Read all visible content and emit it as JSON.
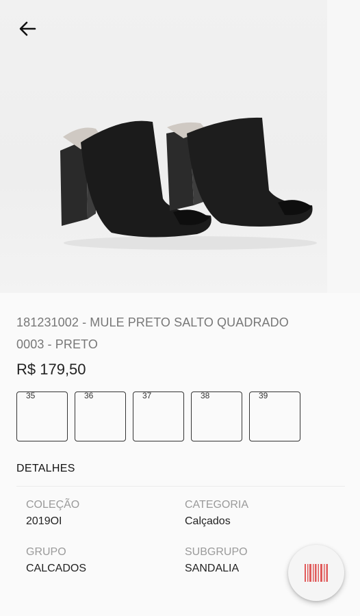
{
  "product": {
    "code_name": "181231002 - MULE PRETO SALTO QUADRADO",
    "variant": "0003 - PRETO",
    "price": "R$ 179,50"
  },
  "sizes": [
    "35",
    "36",
    "37",
    "38",
    "39"
  ],
  "details": {
    "title": "DETALHES",
    "fields": [
      {
        "label": "COLEÇÃO",
        "value": "2019OI"
      },
      {
        "label": "CATEGORIA",
        "value": "Calçados"
      },
      {
        "label": "GRUPO",
        "value": "CALCADOS"
      },
      {
        "label": "SUBGRUPO",
        "value": "SANDALIA"
      }
    ]
  },
  "icons": {
    "back": "arrow-left-icon",
    "fab": "barcode-icon"
  },
  "colors": {
    "barcode_red": "#e05a5a",
    "label_gray": "#9a9a9a"
  }
}
